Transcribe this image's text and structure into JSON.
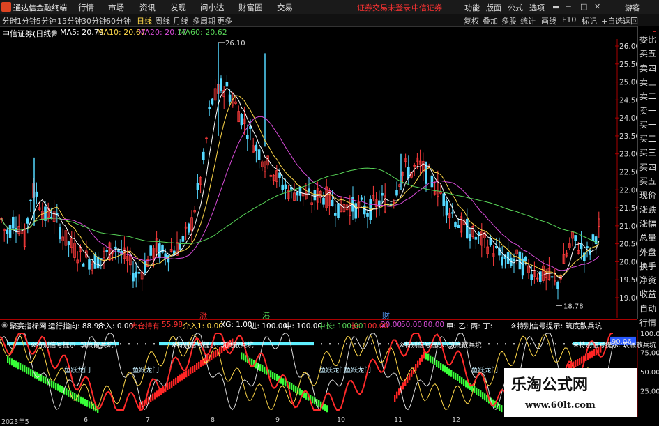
{
  "app": {
    "title": "通达信金融终端",
    "menu": [
      "行情",
      "市场",
      "资讯",
      "发现",
      "问小达",
      "财富圈",
      "交易"
    ],
    "warn1": "证券交易未登录",
    "warn2": "中信证券",
    "right_menu": [
      "功能",
      "版面",
      "公式",
      "选项"
    ],
    "guest": "游客"
  },
  "periods": [
    "分时",
    "1分钟",
    "5分钟",
    "15分钟",
    "30分钟",
    "60分钟",
    "日线",
    "周线",
    "月线",
    "多周期",
    "更多"
  ],
  "selected_period": "日线",
  "toolbar": [
    "复权",
    "叠加",
    "多股",
    "统计",
    "画线",
    "F10",
    "标记",
    "+自选",
    "返回"
  ],
  "stock": {
    "name": "中信证券(日线)"
  },
  "ma": [
    {
      "label": "MA5: 20.79",
      "color": "#ffffff"
    },
    {
      "label": "MA10: 20.67",
      "color": "#ffd84a"
    },
    {
      "label": "MA20: 20.17",
      "color": "#d64bd6"
    },
    {
      "label": "MA60: 20.62",
      "color": "#58d658"
    }
  ],
  "price_axis": [
    "26.00",
    "25.50",
    "25.00",
    "24.50",
    "24.00",
    "23.50",
    "23.00",
    "22.50",
    "22.00",
    "21.50",
    "21.00",
    "20.50",
    "20.00",
    "19.50",
    "19.00"
  ],
  "annotations": {
    "high": "26.10",
    "low": "18.78"
  },
  "book": [
    "委比",
    "卖五",
    "卖四",
    "卖三",
    "卖二",
    "卖一",
    "买一",
    "买二",
    "买三",
    "买四",
    "买五",
    "现价",
    "涨跌",
    "涨幅",
    "总量",
    "外盘",
    "换手",
    "净资",
    "收益",
    "自动",
    "行情"
  ],
  "book_top_marker": "L",
  "indicator": {
    "name": "聚赛指标网",
    "items": [
      {
        "text": "运行指向: 88.98",
        "color": "#ffffff"
      },
      {
        "text": "介入: 0.00",
        "color": "#ffffff"
      },
      {
        "text": "大仓持有",
        "color": "#ff3030"
      },
      {
        "text": "55.98",
        "color": "#ff3030"
      },
      {
        "text": "介入1: 0.00",
        "color": "#ffd84a"
      },
      {
        "text": "XG: 1.00",
        "color": "#ffffff"
      },
      {
        "text": "进: 100.00",
        "color": "#ffffff"
      },
      {
        "text": "中: 100.00",
        "color": "#ffffff"
      },
      {
        "text": "中长: 100.00",
        "color": "#58d658"
      },
      {
        "text": "长: 100.00",
        "color": "#ff3030"
      },
      {
        "text": "20.00",
        "color": "#d64bd6"
      },
      {
        "text": "50.00",
        "color": "#d64bd6"
      },
      {
        "text": "80.00",
        "color": "#d64bd6"
      },
      {
        "text": "甲: 乙: 丙: 丁:",
        "color": "#ffffff"
      },
      {
        "text": "※特别信号提示: 筑底散兵坑",
        "color": "#ffffff"
      }
    ],
    "axis": [
      "100.00",
      "90.06",
      "75.00",
      "50.00",
      "25.00"
    ],
    "tags": [
      {
        "text": "涨",
        "color": "#ff3030"
      },
      {
        "text": "港",
        "color": "#58d658"
      },
      {
        "text": "财",
        "color": "#5aa0ff"
      }
    ],
    "labels": [
      "※特别信号提示: 筑底散兵坑",
      "※特别信号提示: 筑底散兵坑",
      "※特别信号提示: 筑底散兵坑",
      "※特别信号提示: 筑底散兵坑",
      "鱼跃龙门",
      "鱼跃龙门",
      "鱼跃龙门",
      "鱼跃龙门",
      "鱼跃龙门"
    ]
  },
  "dates": [
    "2023年5",
    "6",
    "7",
    "8",
    "9",
    "10",
    "11",
    "12"
  ],
  "watermark": {
    "line1": "乐淘公式网",
    "line2": "www.60lt.com"
  }
}
